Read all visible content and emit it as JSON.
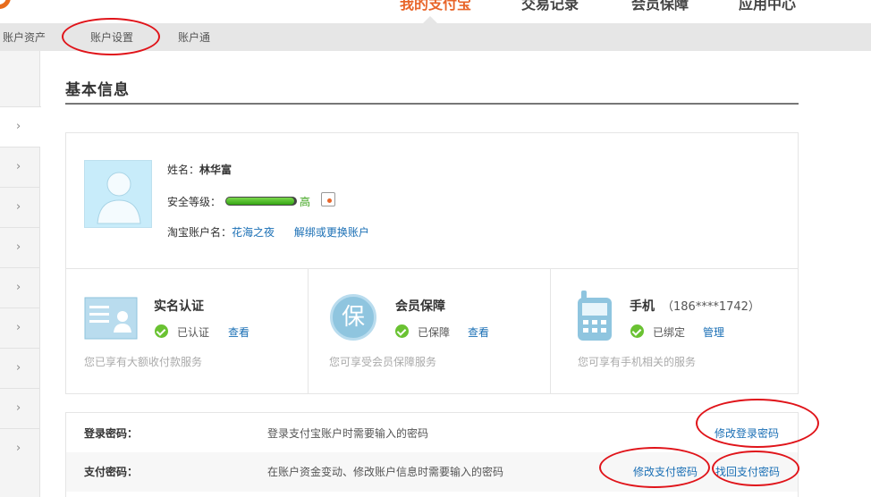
{
  "top_nav": {
    "items": [
      "我的支付宝",
      "交易记录",
      "会员保障",
      "应用中心"
    ],
    "accent_color": "#e8652a"
  },
  "sub_nav": {
    "items": [
      "账户资产",
      "账户设置",
      "账户通"
    ]
  },
  "page": {
    "title": "基本信息"
  },
  "profile": {
    "name_label": "姓名：",
    "name_value": "林华富",
    "security_label": "安全等级：",
    "security_level": "高",
    "security_progress": 0.97,
    "taobao_label": "淘宝账户名：",
    "taobao_value": "花海之夜",
    "unbind_link": "解绑或更换账户"
  },
  "features": [
    {
      "title": "实名认证",
      "status": "已认证",
      "action": "查看",
      "desc": "您已享有大额收付款服务",
      "icon": "id-card-icon"
    },
    {
      "title": "会员保障",
      "status": "已保障",
      "action": "查看",
      "desc": "您可享受会员保障服务",
      "icon": "protection-icon",
      "icon_char": "保"
    },
    {
      "title": "手机",
      "phone": "（186****1742）",
      "status": "已绑定",
      "action": "管理",
      "desc": "您可享有手机相关的服务",
      "icon": "mobile-phone-icon"
    }
  ],
  "passwords": [
    {
      "label": "登录密码：",
      "desc": "登录支付宝账户时需要输入的密码",
      "links": [
        "修改登录密码"
      ]
    },
    {
      "label": "支付密码：",
      "desc": "在账户资金变动、修改账户信息时需要输入的密码",
      "links": [
        "修改支付密码",
        "找回支付密码"
      ]
    }
  ],
  "colors": {
    "link": "#1a6fb5",
    "annotation_circle": "#e0141a",
    "success_green": "#6ac232"
  }
}
